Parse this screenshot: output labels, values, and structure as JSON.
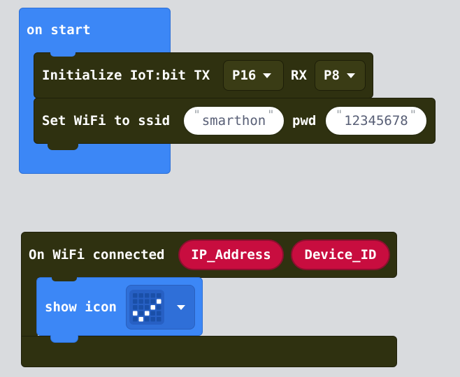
{
  "colors": {
    "event_blue": "#3c87f6",
    "iot_block": "#2f3110",
    "variable_red": "#c80d3f",
    "canvas_bg": "#eceef0"
  },
  "on_start": {
    "label": "on start",
    "init_block": {
      "label": "Initialize IoT:bit TX",
      "tx_value": "P16",
      "rx_label": "RX",
      "rx_value": "P8"
    },
    "wifi_block": {
      "label": "Set WiFi to ssid",
      "ssid_value": "smarthon",
      "pwd_label": "pwd",
      "pwd_value": "12345678"
    }
  },
  "wifi_connected": {
    "label": "On WiFi connected",
    "params": [
      "IP_Address",
      "Device_ID"
    ],
    "show_icon": {
      "label": "show icon",
      "icon_name": "check-mark-led-icon"
    }
  }
}
